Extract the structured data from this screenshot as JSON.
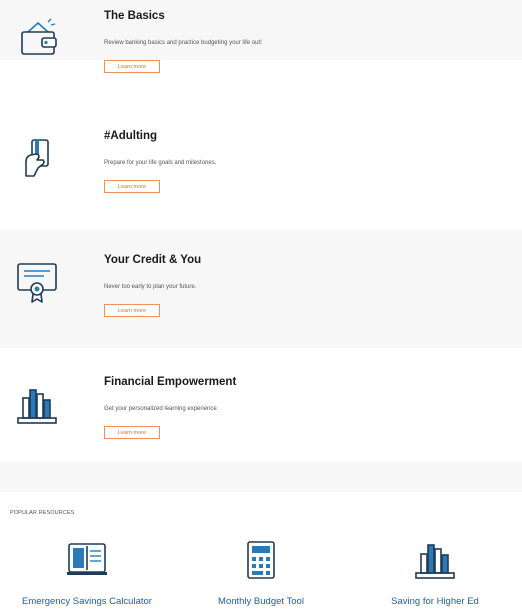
{
  "cards": [
    {
      "title": "The Basics",
      "description": "Review banking basics and practice budgeting your life out!",
      "button": "Learn more",
      "icon": "wallet-icon"
    },
    {
      "title": "#Adulting",
      "description": "Prepare for your life goals and milestones.",
      "button": "Learn more",
      "icon": "card-hand-icon"
    },
    {
      "title": "Your Credit & You",
      "description": "Never too early to plan your future.",
      "button": "Learn more",
      "icon": "certificate-icon"
    },
    {
      "title": "Financial Empowerment",
      "description": "Get your personalized learning experience.",
      "button": "Learn more",
      "icon": "books-icon"
    }
  ],
  "popular": {
    "label": "POPULAR RESOURCES",
    "items": [
      {
        "label": "Emergency Savings Calculator",
        "icon": "open-book-icon"
      },
      {
        "label": "Monthly Budget Tool",
        "icon": "calculator-icon"
      },
      {
        "label": "Saving for Higher Ed",
        "icon": "books-icon"
      }
    ]
  },
  "colors": {
    "accent": "#ef6a2b",
    "link": "#1f5fa8",
    "icon_blue": "#2a7ab8",
    "icon_dark": "#1f3b57"
  }
}
